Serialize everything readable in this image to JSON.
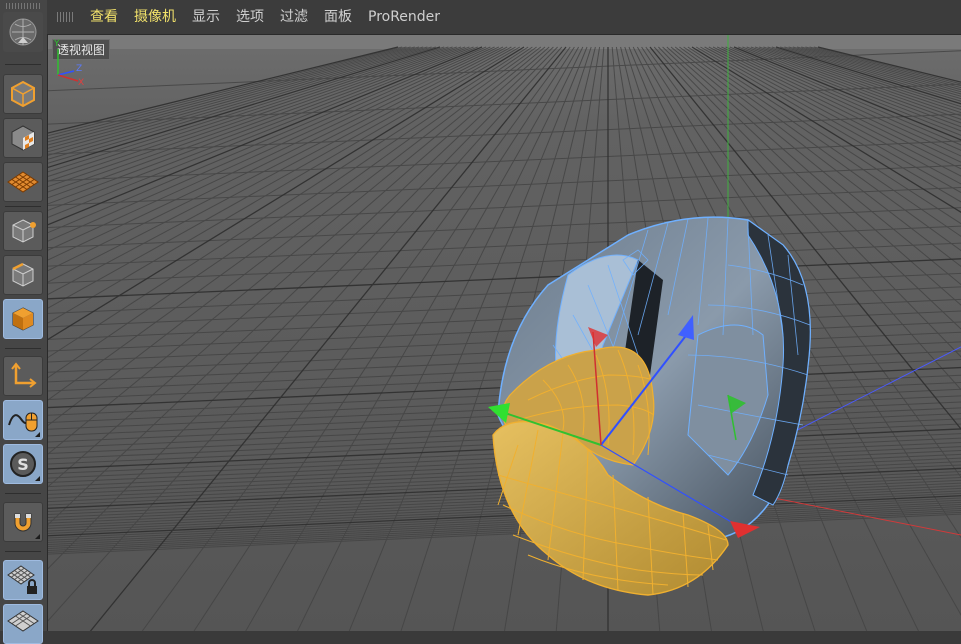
{
  "menu": {
    "items": [
      {
        "label": "查看",
        "highlight": true
      },
      {
        "label": "摄像机",
        "highlight": true
      },
      {
        "label": "显示",
        "highlight": false
      },
      {
        "label": "选项",
        "highlight": false
      },
      {
        "label": "过滤",
        "highlight": false
      },
      {
        "label": "面板",
        "highlight": false
      },
      {
        "label": "ProRender",
        "highlight": false
      }
    ]
  },
  "viewport": {
    "label": "透视视图",
    "axis_labels": {
      "y": "Y",
      "z": "Z",
      "x": "X"
    }
  },
  "toolbar": {
    "tools": [
      {
        "name": "view-tool-icon"
      },
      {
        "name": "model-mode-icon"
      },
      {
        "name": "texture-mode-icon"
      },
      {
        "name": "workplane-mode-icon"
      },
      {
        "name": "points-mode-icon"
      },
      {
        "name": "edges-mode-icon"
      },
      {
        "name": "polygons-mode-icon"
      },
      {
        "name": "axis-mode-icon"
      },
      {
        "name": "tweak-mode-icon"
      },
      {
        "name": "snap-icon"
      },
      {
        "name": "magnet-icon"
      },
      {
        "name": "workplane-lock-icon"
      },
      {
        "name": "grid-icon"
      }
    ]
  },
  "colors": {
    "menu_highlight": "#f0e06a",
    "active_tool": "#8aa7c8",
    "selection": "#f0b030",
    "wire": "#6fb0ff",
    "axis_x": "#e03030",
    "axis_y": "#30c030",
    "axis_z": "#3050ff"
  }
}
